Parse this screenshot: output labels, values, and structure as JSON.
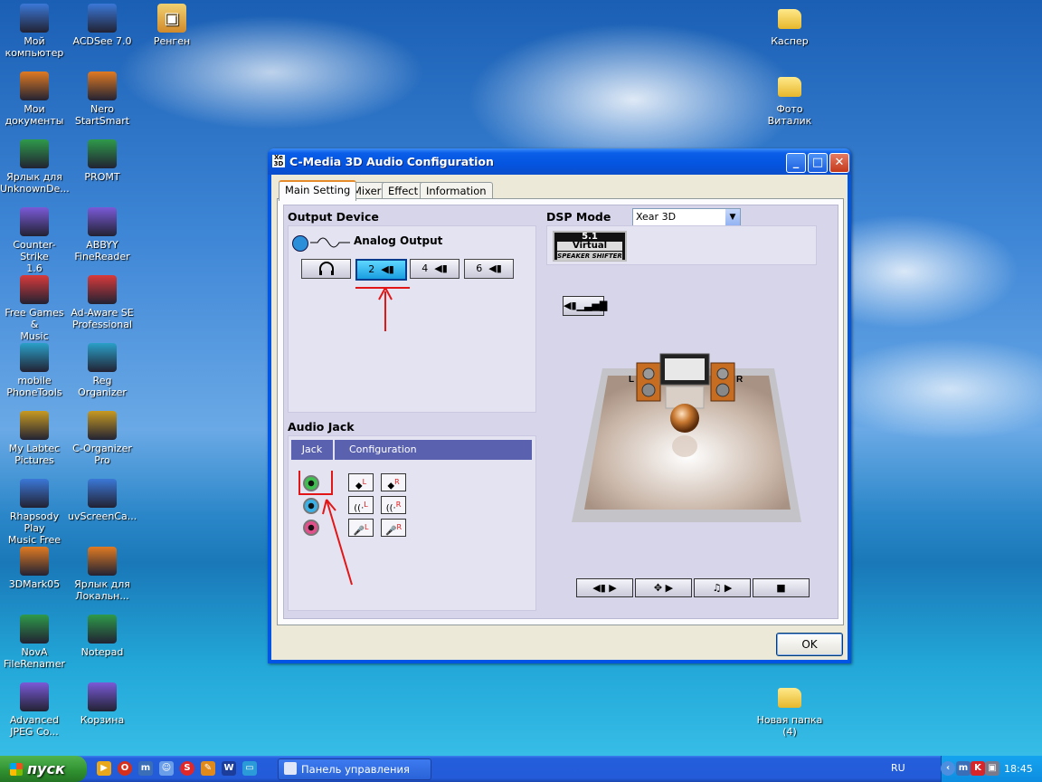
{
  "desktop": {
    "icons_left": [
      {
        "label": "Мой\nкомпьютер",
        "icon": "computer-icon"
      },
      {
        "label": "Мои\nдокументы",
        "icon": "documents-folder-icon"
      },
      {
        "label": "Ярлык для\nUnknownDe...",
        "icon": "shortcut-icon"
      },
      {
        "label": "Counter-Strike\n1.6",
        "icon": "game-icon"
      },
      {
        "label": "Free Games &\nMusic",
        "icon": "gift-icon"
      },
      {
        "label": "mobile\nPhoneTools",
        "icon": "phone-icon"
      },
      {
        "label": "My Labtec\nPictures",
        "icon": "pictures-icon"
      },
      {
        "label": "Rhapsody Play\nMusic Free",
        "icon": "music-icon"
      },
      {
        "label": "3DMark05",
        "icon": "benchmark-icon"
      },
      {
        "label": "NovA\nFileRenamer",
        "icon": "file-renamer-icon"
      },
      {
        "label": "Advanced\nJPEG Co...",
        "icon": "jpeg-icon"
      }
    ],
    "icons_col2": [
      {
        "label": "ACDSee 7.0",
        "icon": "acdsee-icon"
      },
      {
        "label": "Nero\nStartSmart",
        "icon": "nero-icon"
      },
      {
        "label": "PROMT",
        "icon": "promt-icon"
      },
      {
        "label": "ABBYY\nFineReader",
        "icon": "scanner-icon"
      },
      {
        "label": "Ad-Aware SE\nProfessional",
        "icon": "adaware-icon"
      },
      {
        "label": "Reg Organizer",
        "icon": "registry-icon"
      },
      {
        "label": "C-Organizer\nPro",
        "icon": "organizer-icon"
      },
      {
        "label": "uvScreenCa...",
        "icon": "screencam-icon"
      },
      {
        "label": "Ярлык для\nЛокальн...",
        "icon": "drive-shortcut-icon"
      },
      {
        "label": "Notepad",
        "icon": "notepad-icon"
      },
      {
        "label": "Корзина",
        "icon": "recycle-bin-icon"
      }
    ],
    "icon_col3": {
      "label": "Ренген",
      "icon": "jpg-file-icon"
    },
    "icons_right": [
      {
        "label": "Каспер",
        "icon": "folder-icon"
      },
      {
        "label": "Фото Виталик",
        "icon": "folder-icon"
      },
      {
        "label": "Новая папка\n(4)",
        "icon": "folder-icon"
      }
    ]
  },
  "window": {
    "title": "C-Media 3D Audio Configuration",
    "icon_text": "Xear 3D",
    "tabs": [
      {
        "label": "Main Setting",
        "active": true
      },
      {
        "label": "Mixer",
        "active": false
      },
      {
        "label": "Effect",
        "active": false
      },
      {
        "label": "Information",
        "active": false
      }
    ],
    "output_device": {
      "heading": "Output Device",
      "analog_label": "Analog Output",
      "speaker_buttons": [
        {
          "label": "",
          "icon": "headphones-icon"
        },
        {
          "label": "2",
          "icon": "speaker-icon",
          "selected": true
        },
        {
          "label": "4",
          "icon": "speaker-icon"
        },
        {
          "label": "6",
          "icon": "speaker-icon"
        }
      ]
    },
    "audio_jack": {
      "heading": "Audio Jack",
      "columns": [
        "Jack",
        "Configuration"
      ],
      "jacks": [
        {
          "color": "#3fbf4f",
          "icon": "green-jack-icon"
        },
        {
          "color": "#3ab0e6",
          "icon": "blue-jack-icon"
        },
        {
          "color": "#e0508a",
          "icon": "pink-jack-icon"
        }
      ],
      "config_rows": [
        [
          {
            "glyph": "◆",
            "tag": "L"
          },
          {
            "glyph": "◆",
            "tag": "R"
          }
        ],
        [
          {
            "glyph": "((·",
            "tag": "L"
          },
          {
            "glyph": "((·",
            "tag": "R"
          }
        ],
        [
          {
            "glyph": "🎤",
            "tag": "L"
          },
          {
            "glyph": "🎤",
            "tag": "R"
          }
        ]
      ]
    },
    "dsp": {
      "heading": "DSP Mode",
      "selected": "Xear 3D",
      "badge_line1": "5.1",
      "badge_line2": "Virtual",
      "badge_line3": "SPEAKER SHIFTER",
      "left_label": "L",
      "right_label": "R",
      "controls": [
        "speaker-test",
        "rotate",
        "music",
        "stop"
      ]
    },
    "ok_label": "OK"
  },
  "taskbar": {
    "start_label": "пуск",
    "task_label": "Панель управления",
    "language": "RU",
    "clock": "18:45"
  },
  "colors": {
    "annotation_red": "#e21616",
    "xp_blue": "#0055e5",
    "jack_header": "#5a62b0"
  }
}
